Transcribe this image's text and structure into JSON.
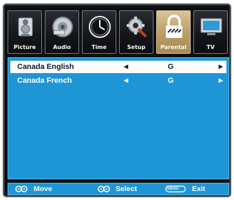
{
  "tabs": [
    {
      "label": "Picture",
      "icon": "picture-icon"
    },
    {
      "label": "Audio",
      "icon": "audio-icon"
    },
    {
      "label": "Time",
      "icon": "clock-icon"
    },
    {
      "label": "Setup",
      "icon": "setup-icon"
    },
    {
      "label": "Parental",
      "icon": "lock-icon",
      "selected": true
    },
    {
      "label": "TV",
      "icon": "tv-icon"
    }
  ],
  "rows": [
    {
      "label": "Canada English",
      "value": "G",
      "left_arrow": "◄",
      "right_arrow": "►",
      "selected": true
    },
    {
      "label": "Canada French",
      "value": "G",
      "left_arrow": "◄",
      "right_arrow": "►",
      "selected": false
    }
  ],
  "footer": {
    "move": {
      "label": "Move",
      "icon": "up-down-icon"
    },
    "select": {
      "label": "Select",
      "icon": "left-right-icon"
    },
    "exit": {
      "label": "Exit",
      "key": "MENU"
    }
  },
  "colors": {
    "background": "#0e0f12",
    "content": "#1e96d6",
    "selected_tab": "#b99b64",
    "selected_row": "#ffffff"
  }
}
